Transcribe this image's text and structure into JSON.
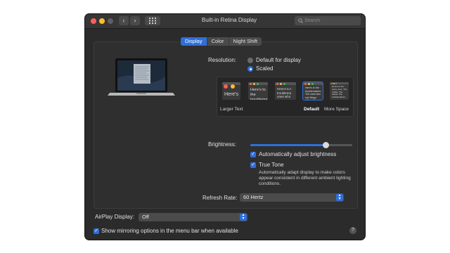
{
  "window": {
    "title": "Built-in Retina Display",
    "back_glyph": "‹",
    "forward_glyph": "›"
  },
  "search": {
    "placeholder": "Search"
  },
  "tabs": [
    {
      "label": "Display",
      "active": true
    },
    {
      "label": "Color",
      "active": false
    },
    {
      "label": "Night Shift",
      "active": false
    }
  ],
  "resolution": {
    "label": "Resolution:",
    "options": [
      {
        "label": "Default for display",
        "selected": false
      },
      {
        "label": "Scaled",
        "selected": true
      }
    ]
  },
  "scaled_options": [
    {
      "caption": "Larger Text",
      "preview_text": "Here's",
      "selected": false
    },
    {
      "caption": "",
      "preview_text": "Here's to the troublemak",
      "selected": false
    },
    {
      "caption": "",
      "preview_text": "Here's to t troublema ones who",
      "selected": false
    },
    {
      "caption": "Default",
      "preview_text": "Here's to the troublemakers. The ones who see things differently.",
      "selected": true
    },
    {
      "caption": "More Space",
      "preview_text": "Here's to the crazy ones. The misfits. The rebels. The troublemakers.",
      "selected": false
    }
  ],
  "brightness": {
    "label": "Brightness:",
    "level": 0.74,
    "auto_label": "Automatically adjust brightness",
    "auto_checked": true
  },
  "true_tone": {
    "label": "True Tone",
    "checked": true,
    "description": "Automatically adapt display to make colors appear consistent in different ambient lighting conditions."
  },
  "refresh_rate": {
    "label": "Refresh Rate:",
    "value": "60 Hertz"
  },
  "airplay": {
    "label": "AirPlay Display:",
    "value": "Off"
  },
  "mirroring": {
    "label": "Show mirroring options in the menu bar when available",
    "checked": true
  },
  "help": {
    "glyph": "?"
  },
  "colors": {
    "accent": "#2f6fd8",
    "window_bg": "#2b2b2b"
  }
}
